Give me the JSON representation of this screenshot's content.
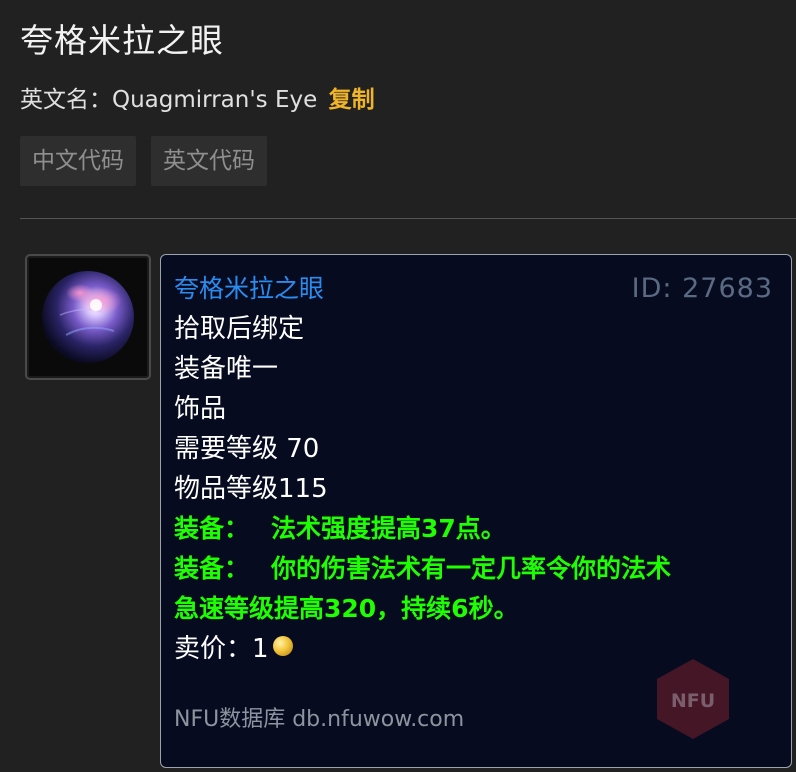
{
  "page": {
    "title": "夸格米拉之眼",
    "english_name_label": "英文名：",
    "english_name": "Quagmirran's Eye",
    "copy_label": "复制"
  },
  "tabs": [
    {
      "label": "中文代码"
    },
    {
      "label": "英文代码"
    }
  ],
  "item": {
    "icon": "purple-eye-orb-icon",
    "name": "夸格米拉之眼",
    "id": "ID: 27683",
    "binding": "拾取后绑定",
    "unique": "装备唯一",
    "slot": "饰品",
    "required_level": "需要等级 70",
    "item_level": "物品等级115",
    "effects": [
      {
        "label": "装备：",
        "text": "法术强度提高37点。"
      },
      {
        "label": "装备：",
        "text": "你的伤害法术有一定几率令你的法术",
        "text2": "急速等级提高320，持续6秒。"
      }
    ],
    "sell_price_label": "卖价：",
    "sell_price_value": "1",
    "watermark": "NFU数据库 db.nfuwow.com",
    "badge_text": "NFU"
  },
  "colors": {
    "name_color": "#2a8cf0",
    "effect_color": "#1eff00",
    "copy_color": "#f0b429"
  }
}
